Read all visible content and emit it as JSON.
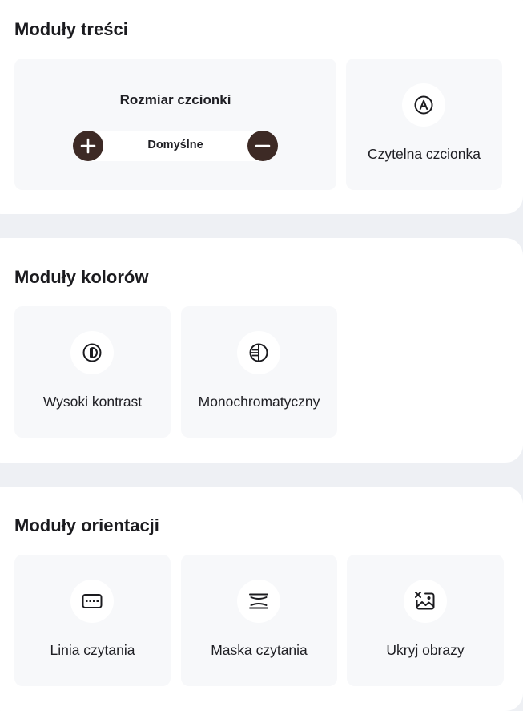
{
  "content_modules": {
    "title": "Moduły treści",
    "font_size": {
      "title": "Rozmiar czcionki",
      "value": "Domyślne",
      "increase_icon": "plus-icon",
      "decrease_icon": "minus-icon"
    },
    "readable_font": {
      "label": "Czytelna czcionka",
      "icon": "readable-font-icon"
    }
  },
  "color_modules": {
    "title": "Moduły kolorów",
    "items": [
      {
        "label": "Wysoki kontrast",
        "icon": "high-contrast-icon"
      },
      {
        "label": "Monochromatyczny",
        "icon": "monochrome-icon"
      }
    ]
  },
  "orientation_modules": {
    "title": "Moduły orientacji",
    "items": [
      {
        "label": "Linia czytania",
        "icon": "reading-line-icon"
      },
      {
        "label": "Maska czytania",
        "icon": "reading-mask-icon"
      },
      {
        "label": "Ukryj obrazy",
        "icon": "hide-images-icon"
      }
    ]
  },
  "colors": {
    "page_background": "#eef0f4",
    "panel_background": "#ffffff",
    "card_background": "#f7f8fa",
    "stepper_button": "#3d2a25",
    "text": "#1b1b1f"
  }
}
